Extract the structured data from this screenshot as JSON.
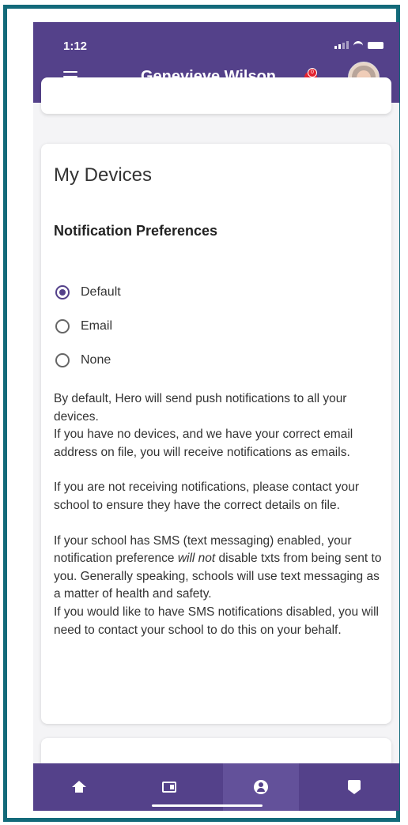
{
  "status_bar": {
    "time": "1:12"
  },
  "header": {
    "title": "Genevieve Wilson",
    "notification_count": "0"
  },
  "card": {
    "title": "My Devices",
    "section_title": "Notification Preferences",
    "options": [
      {
        "label": "Default",
        "selected": true
      },
      {
        "label": "Email",
        "selected": false
      },
      {
        "label": "None",
        "selected": false
      }
    ],
    "paragraphs": [
      "By default, Hero will send push notifications to all your devices.",
      "If you have no devices, and we have your correct email address on file, you will receive notifications as emails.",
      "If you are not receiving notifications, please contact your school to ensure they have the correct details on file.",
      "If your school has SMS (text messaging) enabled, your notification preference",
      "will not",
      "disable txts from being sent to you. Generally speaking, schools will use text messaging as a matter of health and safety.",
      "If you would like to have SMS notifications disabled, you will need to contact your school to do this on your behalf."
    ]
  },
  "colors": {
    "brand": "#54418a",
    "frame": "#136a7a",
    "alert": "#e4222f"
  },
  "bottom_nav": {
    "items": [
      {
        "icon": "home-icon"
      },
      {
        "icon": "feed-icon"
      },
      {
        "icon": "user-icon",
        "active": true
      },
      {
        "icon": "shield-icon"
      }
    ]
  }
}
